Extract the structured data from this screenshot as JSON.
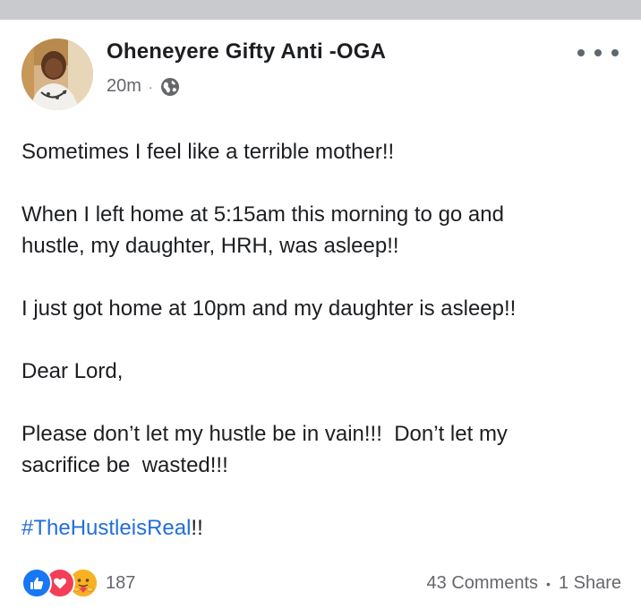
{
  "post": {
    "author": "Oheneyere Gifty Anti -OGA",
    "time": "20m",
    "separator": "·",
    "paragraphs": [
      "Sometimes I feel like a terrible mother!!",
      "When I left home at 5:15am this morning to go and\nhustle, my daughter, HRH, was asleep!!",
      "I just got home at 10pm and my daughter is asleep!!",
      "Dear Lord,",
      "Please don’t let my hustle be in vain!!!  Don’t let my\nsacrifice be  wasted!!!"
    ],
    "hashtag": "#TheHustleisReal",
    "hashtag_suffix": "!!"
  },
  "footer": {
    "reaction_icons": [
      "like-icon",
      "love-icon",
      "care-icon"
    ],
    "reaction_count": "187",
    "comments": "43 Comments",
    "dot": "•",
    "shares": "1 Share"
  },
  "colors": {
    "hashtag": "#216fdb",
    "secondary_text": "#65676b",
    "like": "#1877f2",
    "love": "#f33e58",
    "care": "#f7b125",
    "top_strip": "#c8cacd"
  }
}
